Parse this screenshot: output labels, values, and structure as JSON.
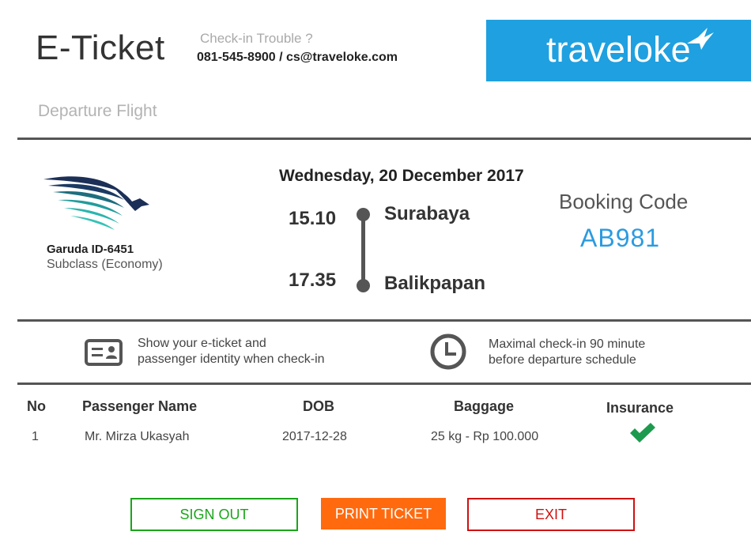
{
  "header": {
    "title": "E-Ticket",
    "trouble_text": "Check-in Trouble ?",
    "contact": "081-545-8900 / cs@traveloke.com",
    "brand": "traveloke",
    "brand_color": "#1fa0e0"
  },
  "section": {
    "subtitle": "Departure Flight"
  },
  "flight": {
    "airline_code": "Garuda  ID-6451",
    "subclass": "Subclass (Economy)",
    "date": "Wednesday, 20 December 2017",
    "depart_time": "15.10",
    "depart_city": "Surabaya",
    "arrive_time": "17.35",
    "arrive_city": "Balikpapan"
  },
  "booking": {
    "label": "Booking Code",
    "code": "AB981",
    "code_color": "#2b9be0"
  },
  "info": [
    {
      "icon": "id-card-icon",
      "line1": "Show your e-ticket and",
      "line2": "passenger identity when check-in"
    },
    {
      "icon": "clock-icon",
      "line1": "Maximal check-in 90 minute",
      "line2": "before departure schedule"
    }
  ],
  "table": {
    "headers": [
      "No",
      "Passenger Name",
      "DOB",
      "Baggage",
      "Insurance"
    ],
    "rows": [
      {
        "no": "1",
        "name": "Mr. Mirza Ukasyah",
        "dob": "2017-12-28",
        "baggage": "25 kg - Rp 100.000",
        "insurance": "check-icon"
      }
    ]
  },
  "buttons": {
    "sign_out": "SIGN OUT",
    "print": "PRINT TICKET",
    "exit": "EXIT",
    "sign_out_color": "#1aa51a",
    "print_color": "#ff6a0f",
    "exit_color": "#d01010"
  }
}
